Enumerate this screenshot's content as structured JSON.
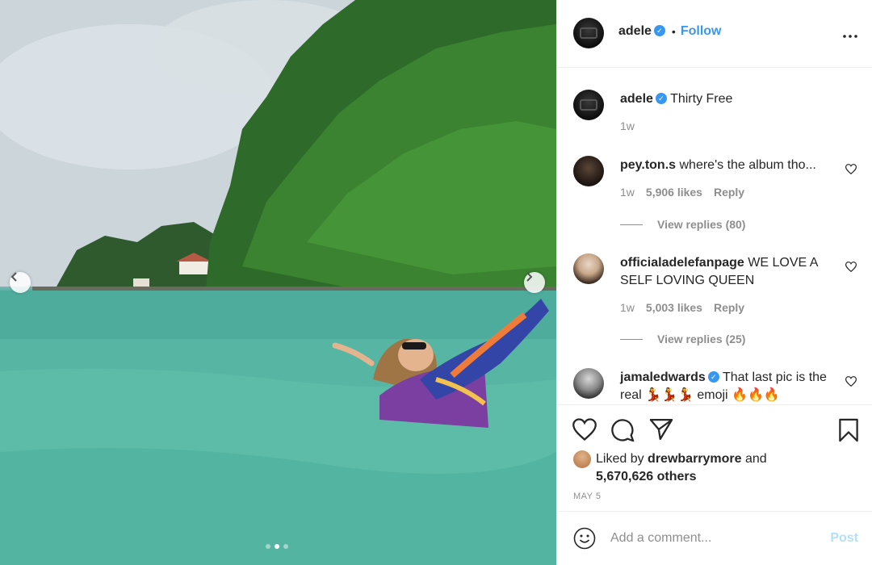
{
  "post": {
    "author": "adele",
    "follow_label": "Follow",
    "separator": "•",
    "more_label": "•••",
    "carousel": {
      "slides": 3,
      "active_slide": 2
    }
  },
  "caption": {
    "username": "adele",
    "text": "Thirty Free",
    "time": "1w"
  },
  "comments": [
    {
      "username": "pey.ton.s",
      "text": "where's the album tho...",
      "time": "1w",
      "likes": "5,906 likes",
      "reply_label": "Reply",
      "view_replies": "View replies (80)"
    },
    {
      "username": "officialadelefanpage",
      "text": "WE LOVE A SELF LOVING QUEEN",
      "time": "1w",
      "likes": "5,003 likes",
      "reply_label": "Reply",
      "view_replies": "View replies (25)"
    },
    {
      "username": "jamaledwards",
      "text": "That last pic is the real 💃💃💃 emoji 🔥🔥🔥"
    }
  ],
  "likes": {
    "prefix": "Liked by",
    "user": "drewbarrymore",
    "and": "and",
    "others": "5,670,626 others"
  },
  "date": "MAY 5",
  "add_comment": {
    "placeholder": "Add a comment...",
    "post_label": "Post"
  },
  "colors": {
    "accent": "#3897f0",
    "post_disabled": "#b2dffc",
    "muted": "#8e8e8e",
    "text": "#262626",
    "border": "#efefef"
  }
}
